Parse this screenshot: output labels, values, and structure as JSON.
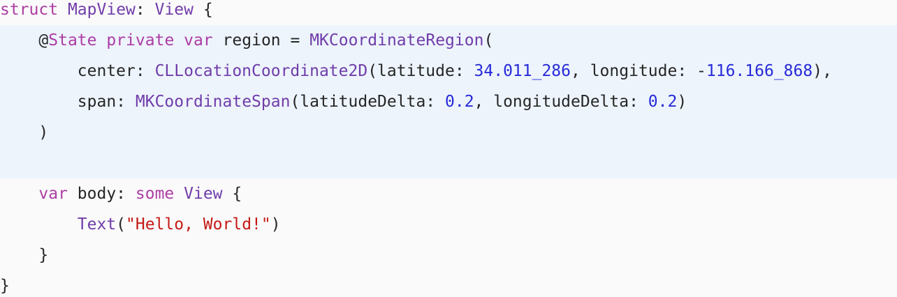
{
  "code": {
    "line1": {
      "kw_struct": "struct",
      "name": "MapView",
      "colon": ": ",
      "type_view": "View",
      "brace": " {"
    },
    "line2": {
      "indent": "    ",
      "attr": "@State",
      "sp1": " ",
      "kw_private": "private",
      "sp2": " ",
      "kw_var": "var",
      "rest": " region = ",
      "type_region": "MKCoordinateRegion",
      "paren": "("
    },
    "line3": {
      "indent": "        ",
      "label": "center: ",
      "type_coord": "CLLocationCoordinate2D",
      "lat_label": "(latitude: ",
      "lat_value": "34.011_286",
      "lon_label": ", longitude: ",
      "lon_minus": "-",
      "lon_value": "116.166_868",
      "end": "),"
    },
    "line4": {
      "indent": "        ",
      "label": "span: ",
      "type_span": "MKCoordinateSpan",
      "lat_label": "(latitudeDelta: ",
      "lat_value": "0.2",
      "lon_label": ", longitudeDelta: ",
      "lon_value": "0.2",
      "end": ")"
    },
    "line5": {
      "indent": "    ",
      "paren": ")"
    },
    "line7": {
      "indent": "    ",
      "kw_var": "var",
      "name": " body: ",
      "kw_some": "some",
      "sp": " ",
      "type_view": "View",
      "brace": " {"
    },
    "line8": {
      "indent": "        ",
      "type_text": "Text",
      "open": "(",
      "string": "\"Hello, World!\"",
      "close": ")"
    },
    "line9": {
      "indent": "    ",
      "brace": "}"
    },
    "line10": {
      "brace": "}"
    }
  },
  "colors": {
    "background": "#fafafa",
    "highlight_background": "#edf4fc",
    "keyword": "#9b2393",
    "type": "#703daa",
    "number": "#272ad8",
    "string": "#c41a16",
    "plain": "#262626"
  }
}
